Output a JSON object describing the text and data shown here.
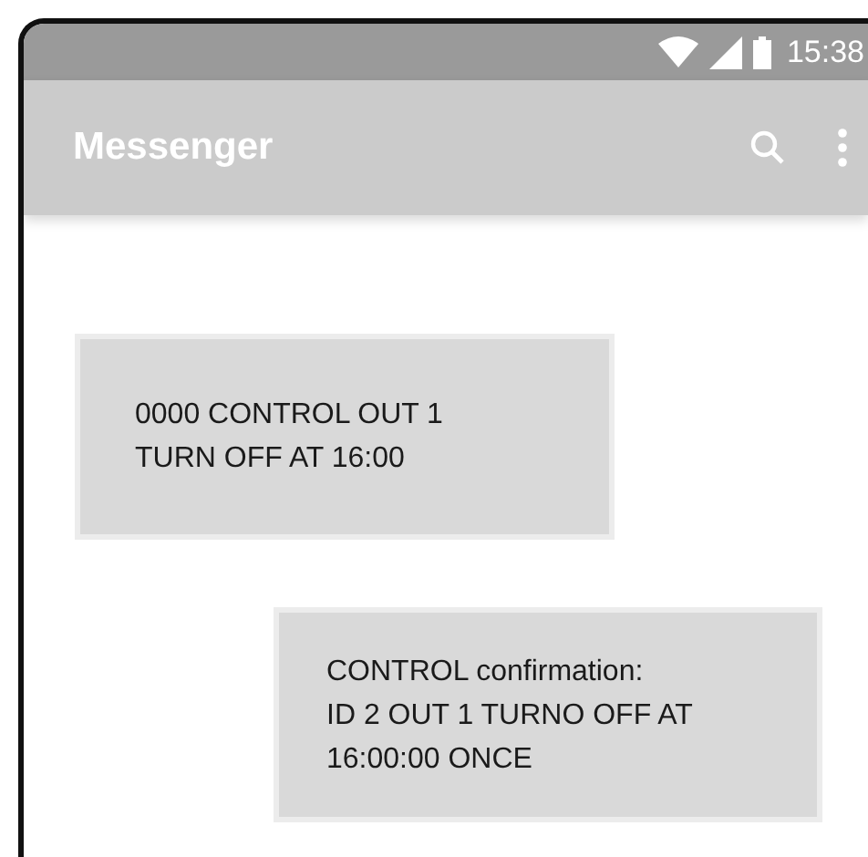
{
  "status_bar": {
    "time": "15:38"
  },
  "app_bar": {
    "title": "Messenger"
  },
  "messages": [
    {
      "kind": "outgoing",
      "text": "0000 CONTROL OUT 1\nTURN OFF AT 16:00"
    },
    {
      "kind": "incoming",
      "text": "CONTROL confirmation:\nID 2 OUT 1 TURNO OFF AT\n16:00:00 ONCE"
    }
  ]
}
